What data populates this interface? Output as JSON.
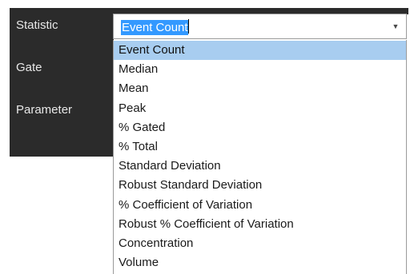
{
  "labels": {
    "statistic": "Statistic",
    "gate": "Gate",
    "parameter": "Parameter"
  },
  "statistic_combo": {
    "value": "Event Count",
    "arrow_icon": "chevron-down-icon"
  },
  "dropdown": {
    "highlighted_index": 0,
    "options": [
      "Event Count",
      "Median",
      "Mean",
      "Peak",
      "% Gated",
      "% Total",
      "Standard Deviation",
      "Robust Standard Deviation",
      "% Coefficient of Variation",
      "Robust % Coefficient of Variation",
      "Concentration",
      "Volume"
    ]
  },
  "colors": {
    "panel_background": "#2b2b2b",
    "label_text": "#e8e8e8",
    "selection": "#3399ff",
    "highlight": "#a8cdf0"
  }
}
